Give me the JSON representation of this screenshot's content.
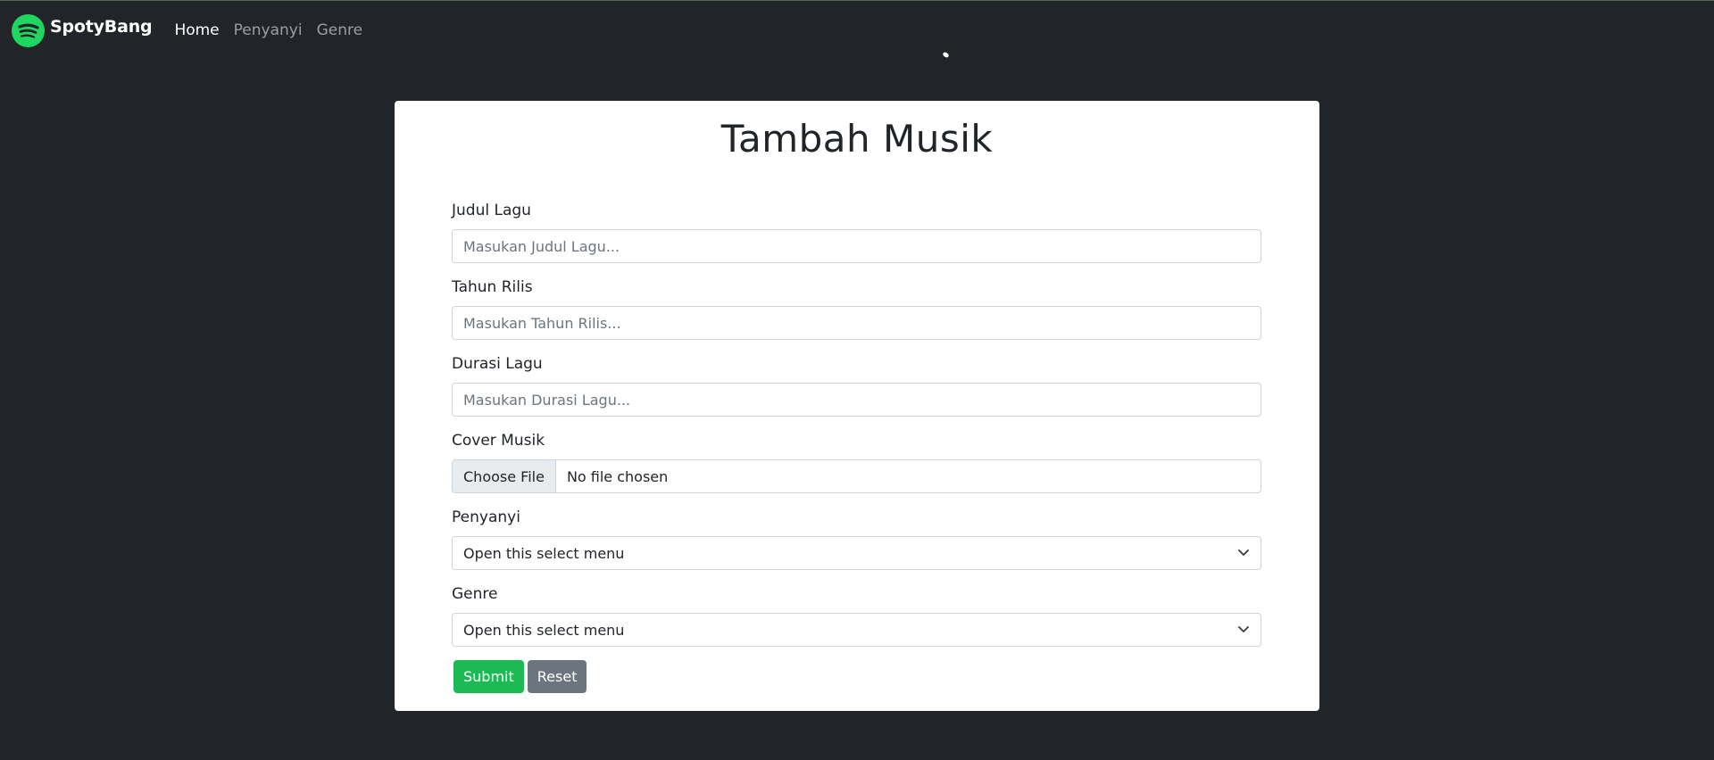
{
  "navbar": {
    "brand": "SpotyBang",
    "links": [
      {
        "label": "Home"
      },
      {
        "label": "Penyanyi"
      },
      {
        "label": "Genre"
      }
    ]
  },
  "form": {
    "title": "Tambah Musik",
    "judul": {
      "label": "Judul Lagu",
      "placeholder": "Masukan Judul Lagu...",
      "value": ""
    },
    "tahun": {
      "label": "Tahun Rilis",
      "placeholder": "Masukan Tahun Rilis...",
      "value": ""
    },
    "durasi": {
      "label": "Durasi Lagu",
      "placeholder": "Masukan Durasi Lagu...",
      "value": ""
    },
    "cover": {
      "label": "Cover Musik",
      "button": "Choose File",
      "status": "No file chosen"
    },
    "penyanyi": {
      "label": "Penyanyi",
      "selected": "Open this select menu"
    },
    "genre": {
      "label": "Genre",
      "selected": "Open this select menu"
    },
    "submit_label": "Submit",
    "reset_label": "Reset"
  },
  "colors": {
    "background": "#212529",
    "brand": "#1ed760",
    "submit": "#1db954",
    "reset": "#6c757d"
  }
}
